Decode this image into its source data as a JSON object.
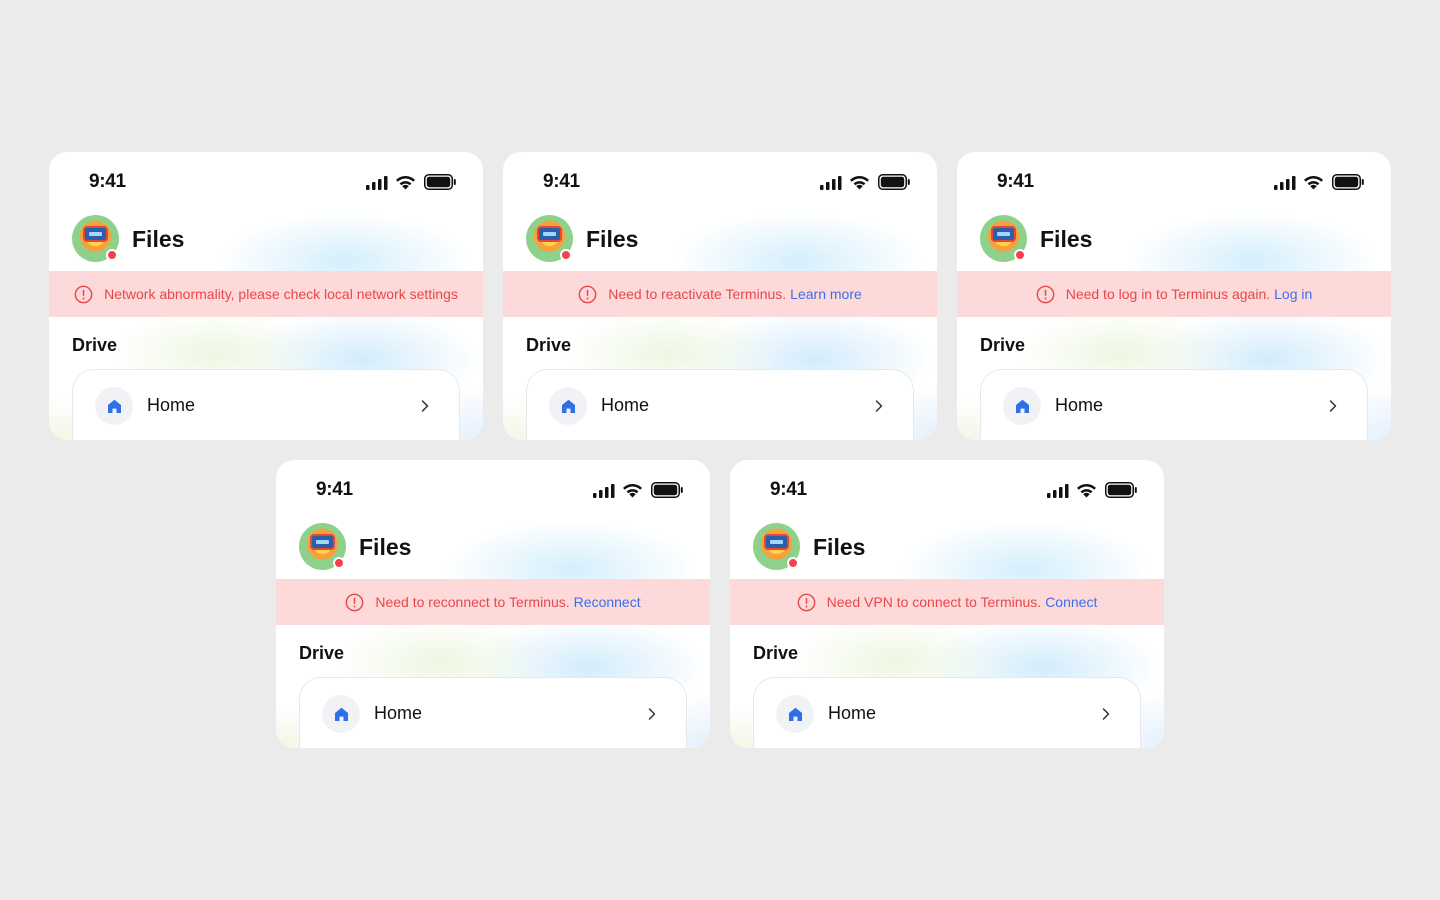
{
  "status_bar": {
    "time": "9:41"
  },
  "app_title": "Files",
  "section_label": "Drive",
  "home_label": "Home",
  "colors": {
    "background": "#ebebeb",
    "banner_background": "#fdd9da",
    "banner_text": "#e8474a",
    "link": "#3d6fe8",
    "status_dot": "#f5424a",
    "home_icon": "#2f6fe8"
  },
  "icons": {
    "signal": "cellular-signal-icon",
    "wifi": "wifi-icon",
    "battery": "battery-icon",
    "warning": "alert-circle-icon",
    "home": "house-icon",
    "chevron": "chevron-right-icon"
  },
  "cards": [
    {
      "message": "Network abnormality, please check local network settings",
      "link": ""
    },
    {
      "message": "Need to reactivate Terminus.",
      "link": "Learn more"
    },
    {
      "message": "Need to log in to Terminus again.",
      "link": "Log in"
    },
    {
      "message": "Need to reconnect to Terminus.",
      "link": "Reconnect"
    },
    {
      "message": "Need VPN to connect to Terminus.",
      "link": "Connect"
    }
  ]
}
